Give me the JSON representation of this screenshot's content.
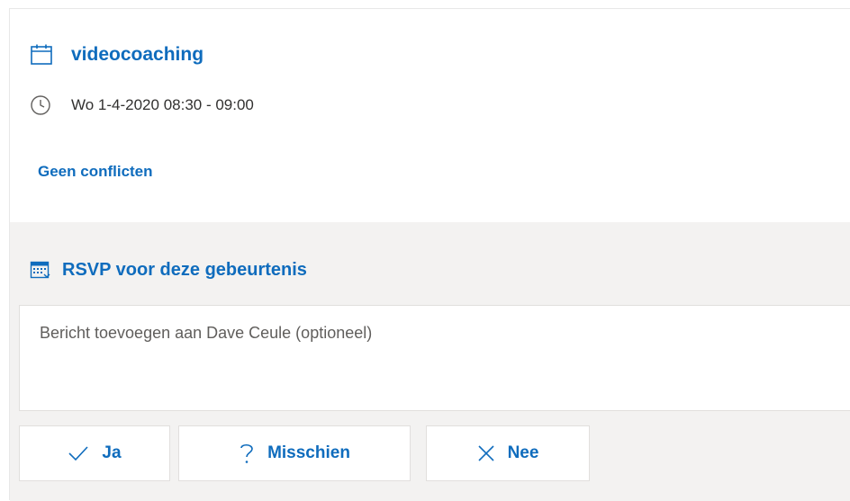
{
  "event": {
    "title": "videocoaching",
    "time": "Wo 1-4-2020 08:30 - 09:00",
    "conflicts": "Geen conflicten",
    "icons": {
      "calendar": "calendar-icon",
      "clock": "clock-icon"
    }
  },
  "rsvp": {
    "heading": "RSVP voor deze gebeurtenis",
    "message_placeholder": "Bericht toevoegen aan Dave Ceule (optioneel)",
    "buttons": {
      "yes": "Ja",
      "maybe": "Misschien",
      "no": "Nee"
    },
    "icons": {
      "heading": "rsvp-calendar-icon",
      "yes": "checkmark-icon",
      "maybe": "question-icon",
      "no": "x-icon"
    }
  },
  "colors": {
    "accent": "#0f6cbd",
    "text": "#323130",
    "muted_text": "#605e5c",
    "panel_background": "#f3f2f1",
    "border": "#e1dfdd"
  }
}
